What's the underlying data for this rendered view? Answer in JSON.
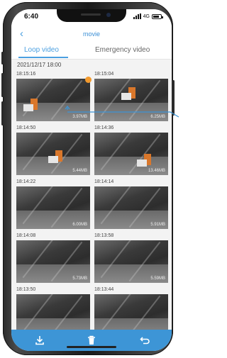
{
  "status": {
    "time": "6:40",
    "network": "4G"
  },
  "header": {
    "title": "movie"
  },
  "tabs": [
    {
      "label": "Loop video",
      "active": true
    },
    {
      "label": "Emergency video",
      "active": false
    }
  ],
  "date": "2021/12/17 18:00",
  "videos": [
    {
      "time": "18:15:16",
      "size": "3.97MB",
      "new": true
    },
    {
      "time": "18:15:04",
      "size": "6.25MB"
    },
    {
      "time": "18:14:50",
      "size": "5.44MB"
    },
    {
      "time": "18:14:36",
      "size": "13.46MB"
    },
    {
      "time": "18:14:22",
      "size": "6.00MB"
    },
    {
      "time": "18:14:14",
      "size": "5.91MB"
    },
    {
      "time": "18:14:08",
      "size": "5.73MB"
    },
    {
      "time": "18:13:58",
      "size": "5.59MB"
    },
    {
      "time": "18:13:50",
      "size": ""
    },
    {
      "time": "18:13:44",
      "size": ""
    }
  ],
  "colors": {
    "accent": "#4a9fe0",
    "bottom_bar": "#3d95d6",
    "badge": "#f29a2e"
  },
  "toolbar": {
    "icons": [
      "download-icon",
      "trash-icon",
      "return-icon"
    ]
  }
}
